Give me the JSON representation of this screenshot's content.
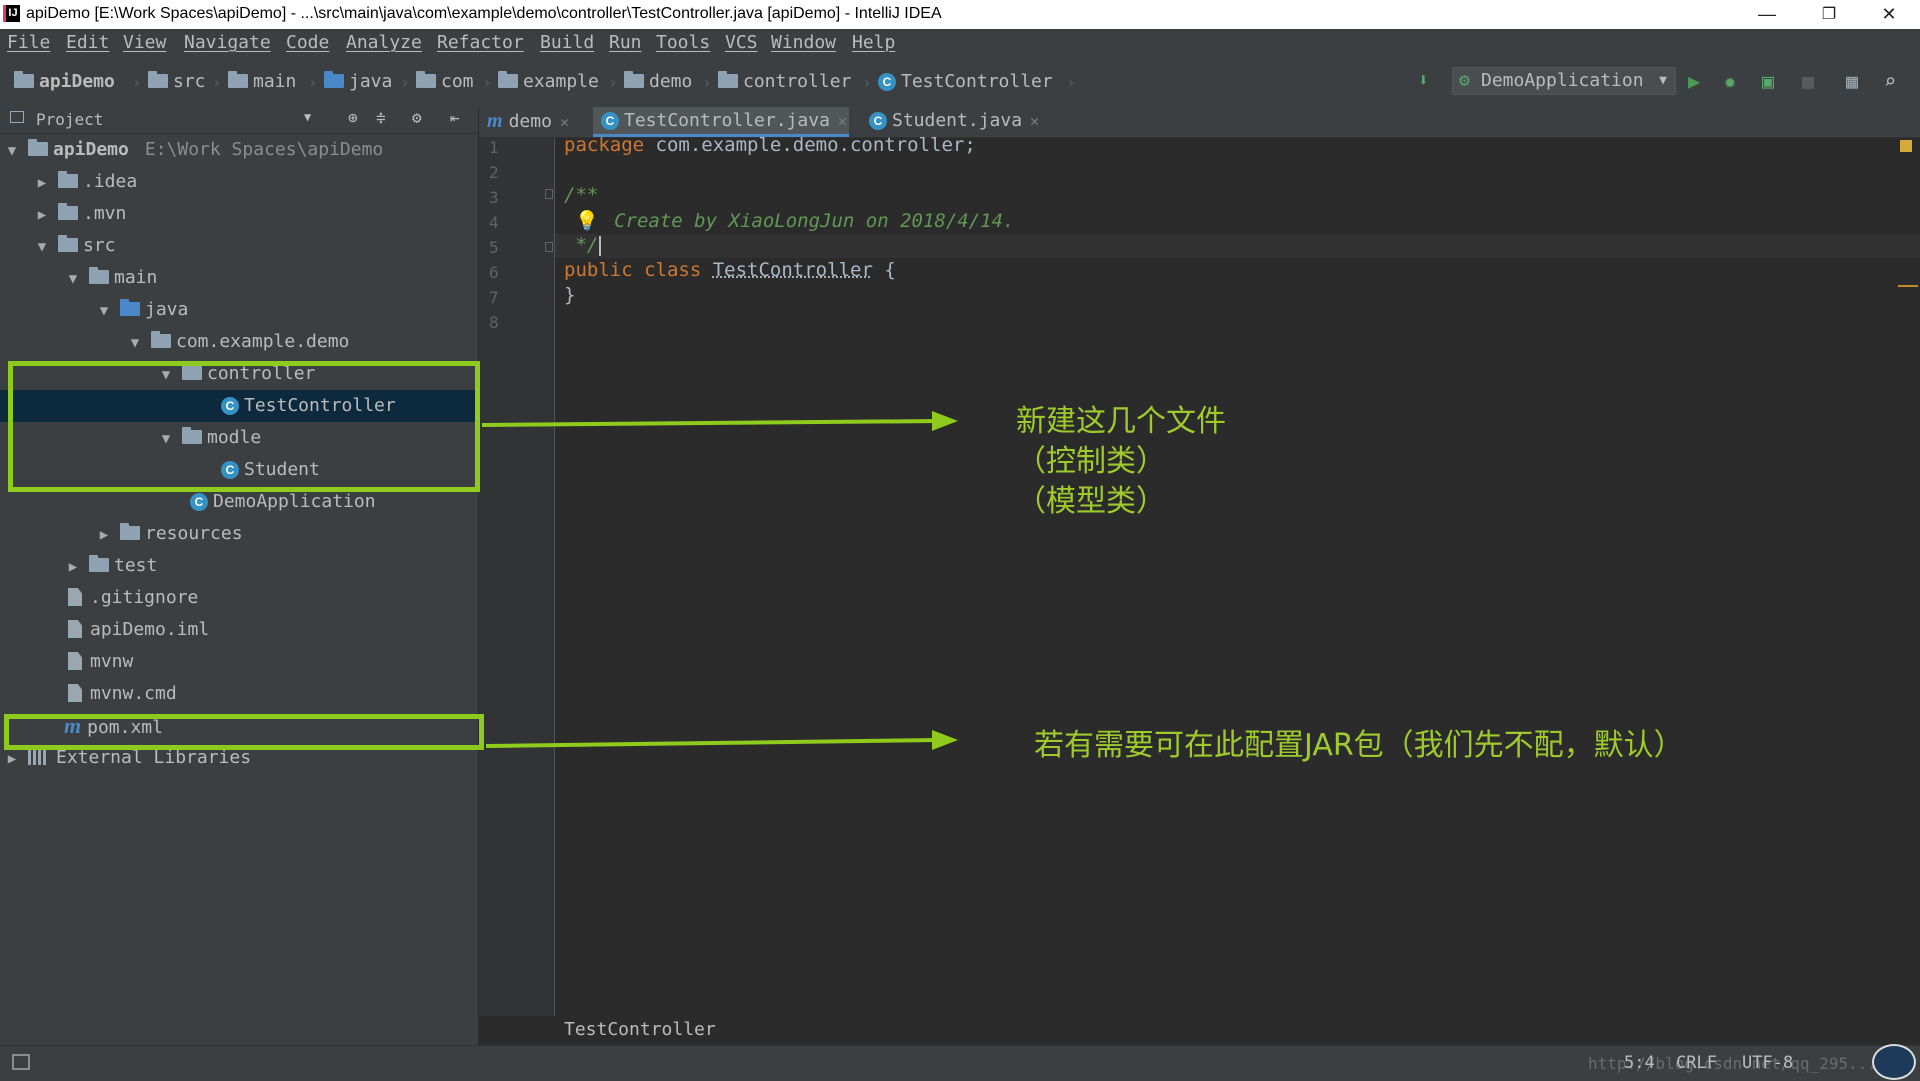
{
  "window": {
    "title": "apiDemo [E:\\Work  Spaces\\apiDemo] - ...\\src\\main\\java\\com\\example\\demo\\controller\\TestController.java [apiDemo] - IntelliJ IDEA",
    "app_icon": "IJ",
    "minimize": "—",
    "restore": "❐",
    "close": "✕"
  },
  "menu": [
    "File",
    "Edit",
    "View",
    "Navigate",
    "Code",
    "Analyze",
    "Refactor",
    "Build",
    "Run",
    "Tools",
    "VCS",
    "Window",
    "Help"
  ],
  "breadcrumb": [
    "apiDemo",
    "src",
    "main",
    "java",
    "com",
    "example",
    "demo",
    "controller",
    "TestController"
  ],
  "toolbar": {
    "run_config": "DemoApplication",
    "icons": [
      "build-icon",
      "run-icon",
      "debug-icon",
      "coverage-icon",
      "stop-icon",
      "project-structure-icon",
      "search-icon"
    ]
  },
  "project_panel": {
    "header": "Project",
    "root": {
      "name": "apiDemo",
      "path": "E:\\Work  Spaces\\apiDemo"
    },
    "items": [
      {
        "label": ".idea"
      },
      {
        "label": ".mvn"
      },
      {
        "label": "src"
      },
      {
        "label": "main"
      },
      {
        "label": "java"
      },
      {
        "label": "com.example.demo"
      },
      {
        "label": "controller"
      },
      {
        "label": "TestController"
      },
      {
        "label": "modle"
      },
      {
        "label": "Student"
      },
      {
        "label": "DemoApplication"
      },
      {
        "label": "resources"
      },
      {
        "label": "test"
      },
      {
        "label": ".gitignore"
      },
      {
        "label": "apiDemo.iml"
      },
      {
        "label": "mvnw"
      },
      {
        "label": "mvnw.cmd"
      },
      {
        "label": "pom.xml"
      },
      {
        "label": "External Libraries"
      }
    ]
  },
  "tabs": [
    {
      "label": "demo"
    },
    {
      "label": "TestController.java",
      "active": true
    },
    {
      "label": "Student.java"
    }
  ],
  "editor": {
    "line_numbers": [
      "1",
      "2",
      "3",
      "4",
      "5",
      "6",
      "7",
      "8"
    ],
    "code": {
      "l1_kw": "package",
      "l1_rest": " com.example.demo.controller;",
      "l3": "/**",
      "l4": " Create by XiaoLongJun on 2018/4/14.",
      "l5": " */",
      "l6_kw": "public class",
      "l6_cls": "TestController",
      "l6_rest": " {",
      "l7": "}"
    },
    "bottom_breadcrumb": "TestController"
  },
  "annotations": {
    "a1_line1": "新建这几个文件",
    "a1_line2": "（控制类）",
    "a1_line3": "（模型类）",
    "a2": "若有需要可在此配置JAR包（我们先不配，默认）",
    "color": "#8fcb1c"
  },
  "status": {
    "position": "5:4",
    "line_sep": "CRLF",
    "encoding": "UTF-8",
    "watermark": "http://blog.csdn.net/qq_295..."
  }
}
